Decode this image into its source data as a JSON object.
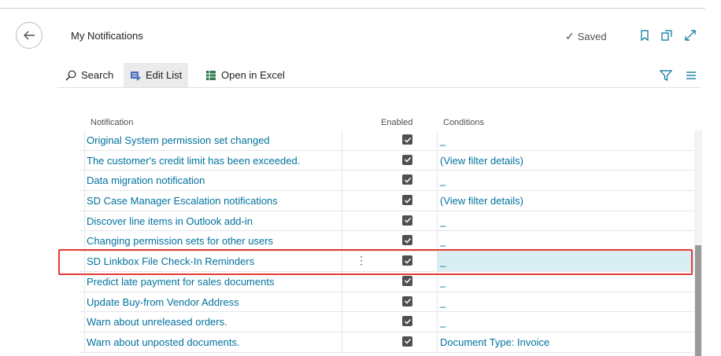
{
  "header": {
    "title": "My Notifications",
    "saved_label": "Saved"
  },
  "actions": {
    "search": "Search",
    "edit_list": "Edit List",
    "open_in_excel": "Open in Excel"
  },
  "columns": {
    "notification": "Notification",
    "enabled": "Enabled",
    "conditions": "Conditions"
  },
  "rows": [
    {
      "notification": "Original System permission set changed",
      "enabled": true,
      "conditions": "_"
    },
    {
      "notification": "The customer's credit limit has been exceeded.",
      "enabled": true,
      "conditions": "(View filter details)"
    },
    {
      "notification": "Data migration notification",
      "enabled": true,
      "conditions": "_"
    },
    {
      "notification": "SD Case Manager Escalation notifications",
      "enabled": true,
      "conditions": "(View filter details)"
    },
    {
      "notification": "Discover line items in Outlook add-in",
      "enabled": true,
      "conditions": "_"
    },
    {
      "notification": "Changing permission sets for other users",
      "enabled": true,
      "conditions": "_"
    },
    {
      "notification": "SD Linkbox File Check-In Reminders",
      "enabled": true,
      "conditions": "_",
      "selected": true
    },
    {
      "notification": "Predict late payment for sales documents",
      "enabled": true,
      "conditions": "_"
    },
    {
      "notification": "Update Buy-from Vendor Address",
      "enabled": true,
      "conditions": "_"
    },
    {
      "notification": "Warn about unreleased orders.",
      "enabled": true,
      "conditions": "_"
    },
    {
      "notification": "Warn about unposted documents.",
      "enabled": true,
      "conditions": "Document Type: Invoice"
    }
  ],
  "icons": {
    "back": "back-arrow-icon",
    "bookmark": "bookmark-icon",
    "open_new_window": "open-new-window-icon",
    "expand": "expand-icon",
    "filter": "filter-icon",
    "list_view": "list-view-icon"
  },
  "colors": {
    "link": "#00729e",
    "selected_bg": "#d9eef3",
    "highlight": "#e53935"
  }
}
